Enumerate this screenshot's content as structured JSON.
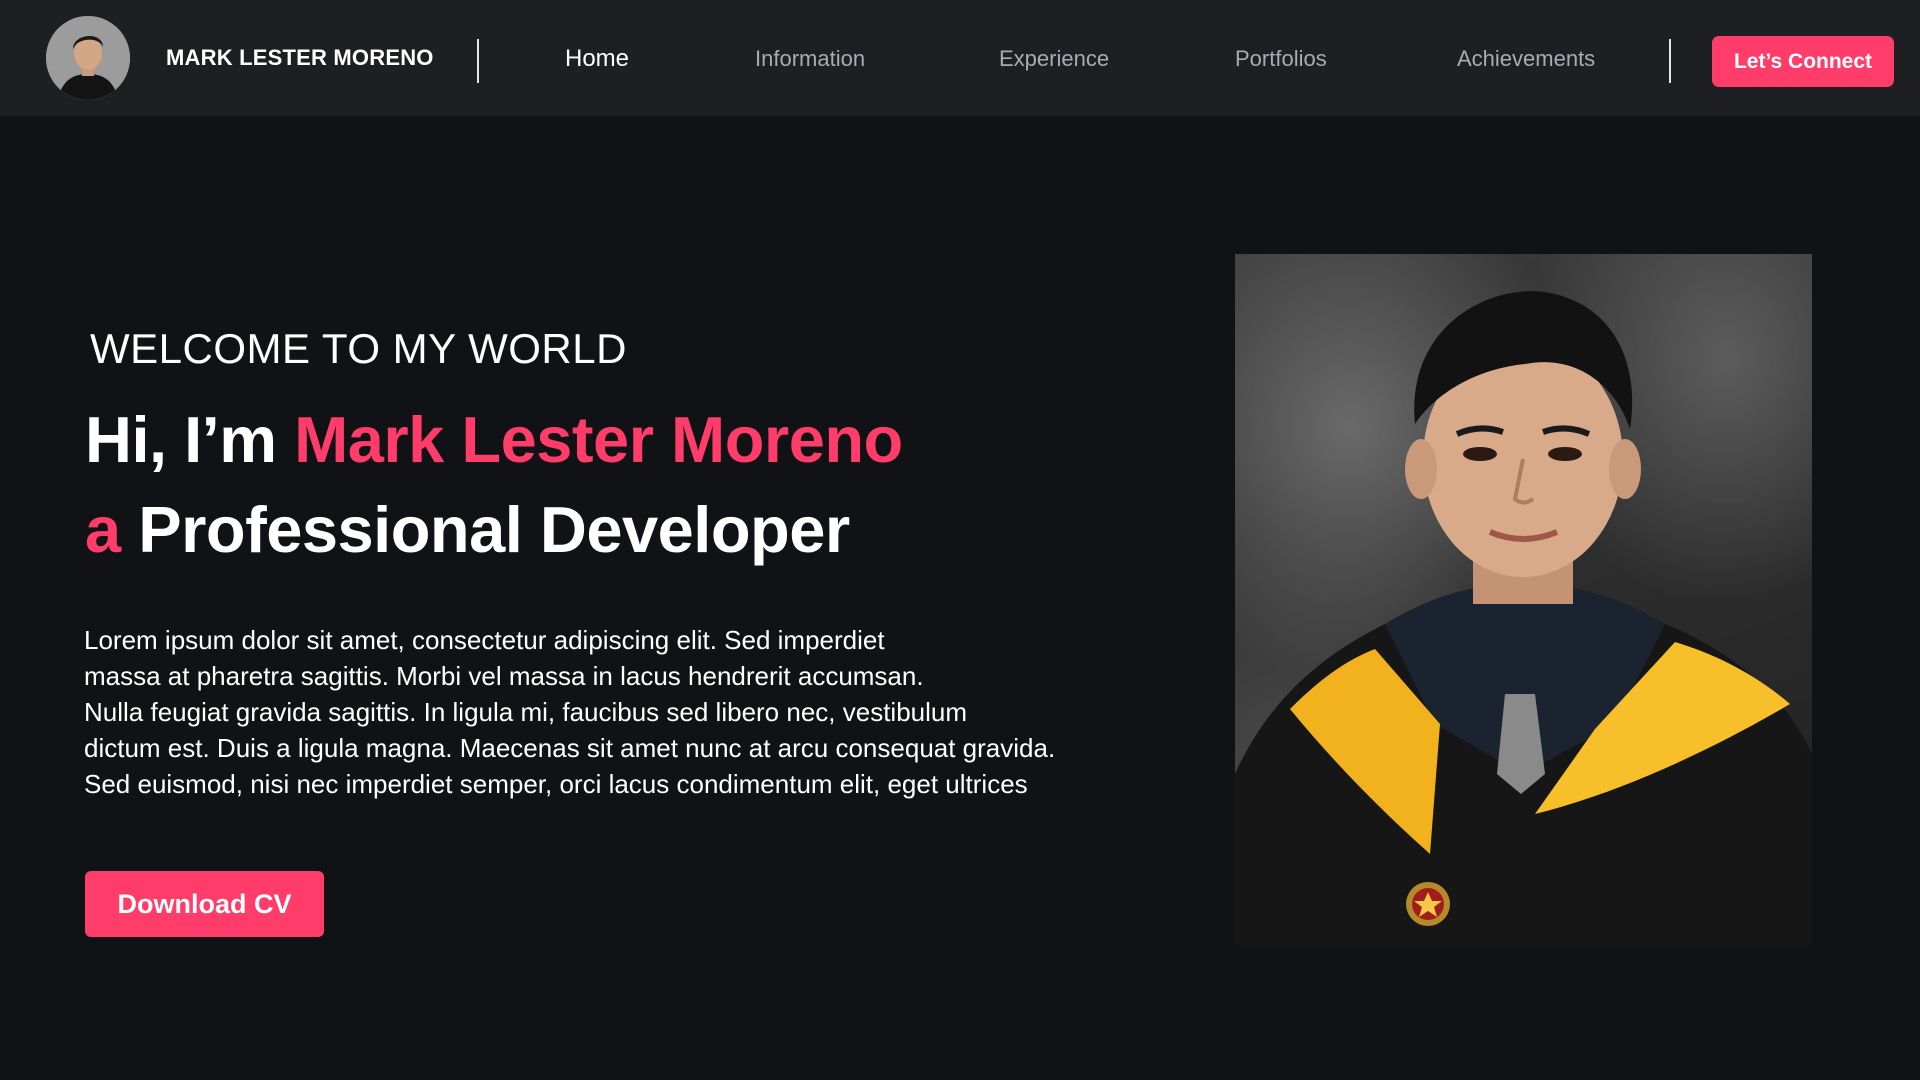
{
  "brand": {
    "name": "MARK LESTER MORENO"
  },
  "nav": {
    "items": [
      {
        "label": "Home",
        "active": true
      },
      {
        "label": "Information",
        "active": false
      },
      {
        "label": "Experience",
        "active": false
      },
      {
        "label": "Portfolios",
        "active": false
      },
      {
        "label": "Achievements",
        "active": false
      }
    ],
    "cta_label": "Let’s Connect"
  },
  "hero": {
    "welcome": "WELCOME TO MY WORLD",
    "greeting_prefix": "Hi, I’m ",
    "name": "Mark Lester Moreno",
    "role_prefix": "a",
    "role": "Professional Developer",
    "description_lines": [
      "Lorem ipsum dolor sit amet, consectetur adipiscing elit. Sed imperdiet",
      "massa at pharetra sagittis. Morbi vel massa in lacus hendrerit accumsan.",
      "Nulla feugiat gravida sagittis. In ligula mi, faucibus sed libero nec, vestibulum",
      "dictum est. Duis a ligula magna. Maecenas sit amet nunc at arcu consequat gravida.",
      "Sed euismod, nisi nec imperdiet semper, orci lacus condimentum elit, eget ultrices"
    ],
    "cv_button": "Download CV"
  },
  "colors": {
    "accent": "#ff3c6a",
    "page_bg": "#111215",
    "nav_bg": "#1e1f22",
    "nav_inactive": "#a9abb0"
  }
}
